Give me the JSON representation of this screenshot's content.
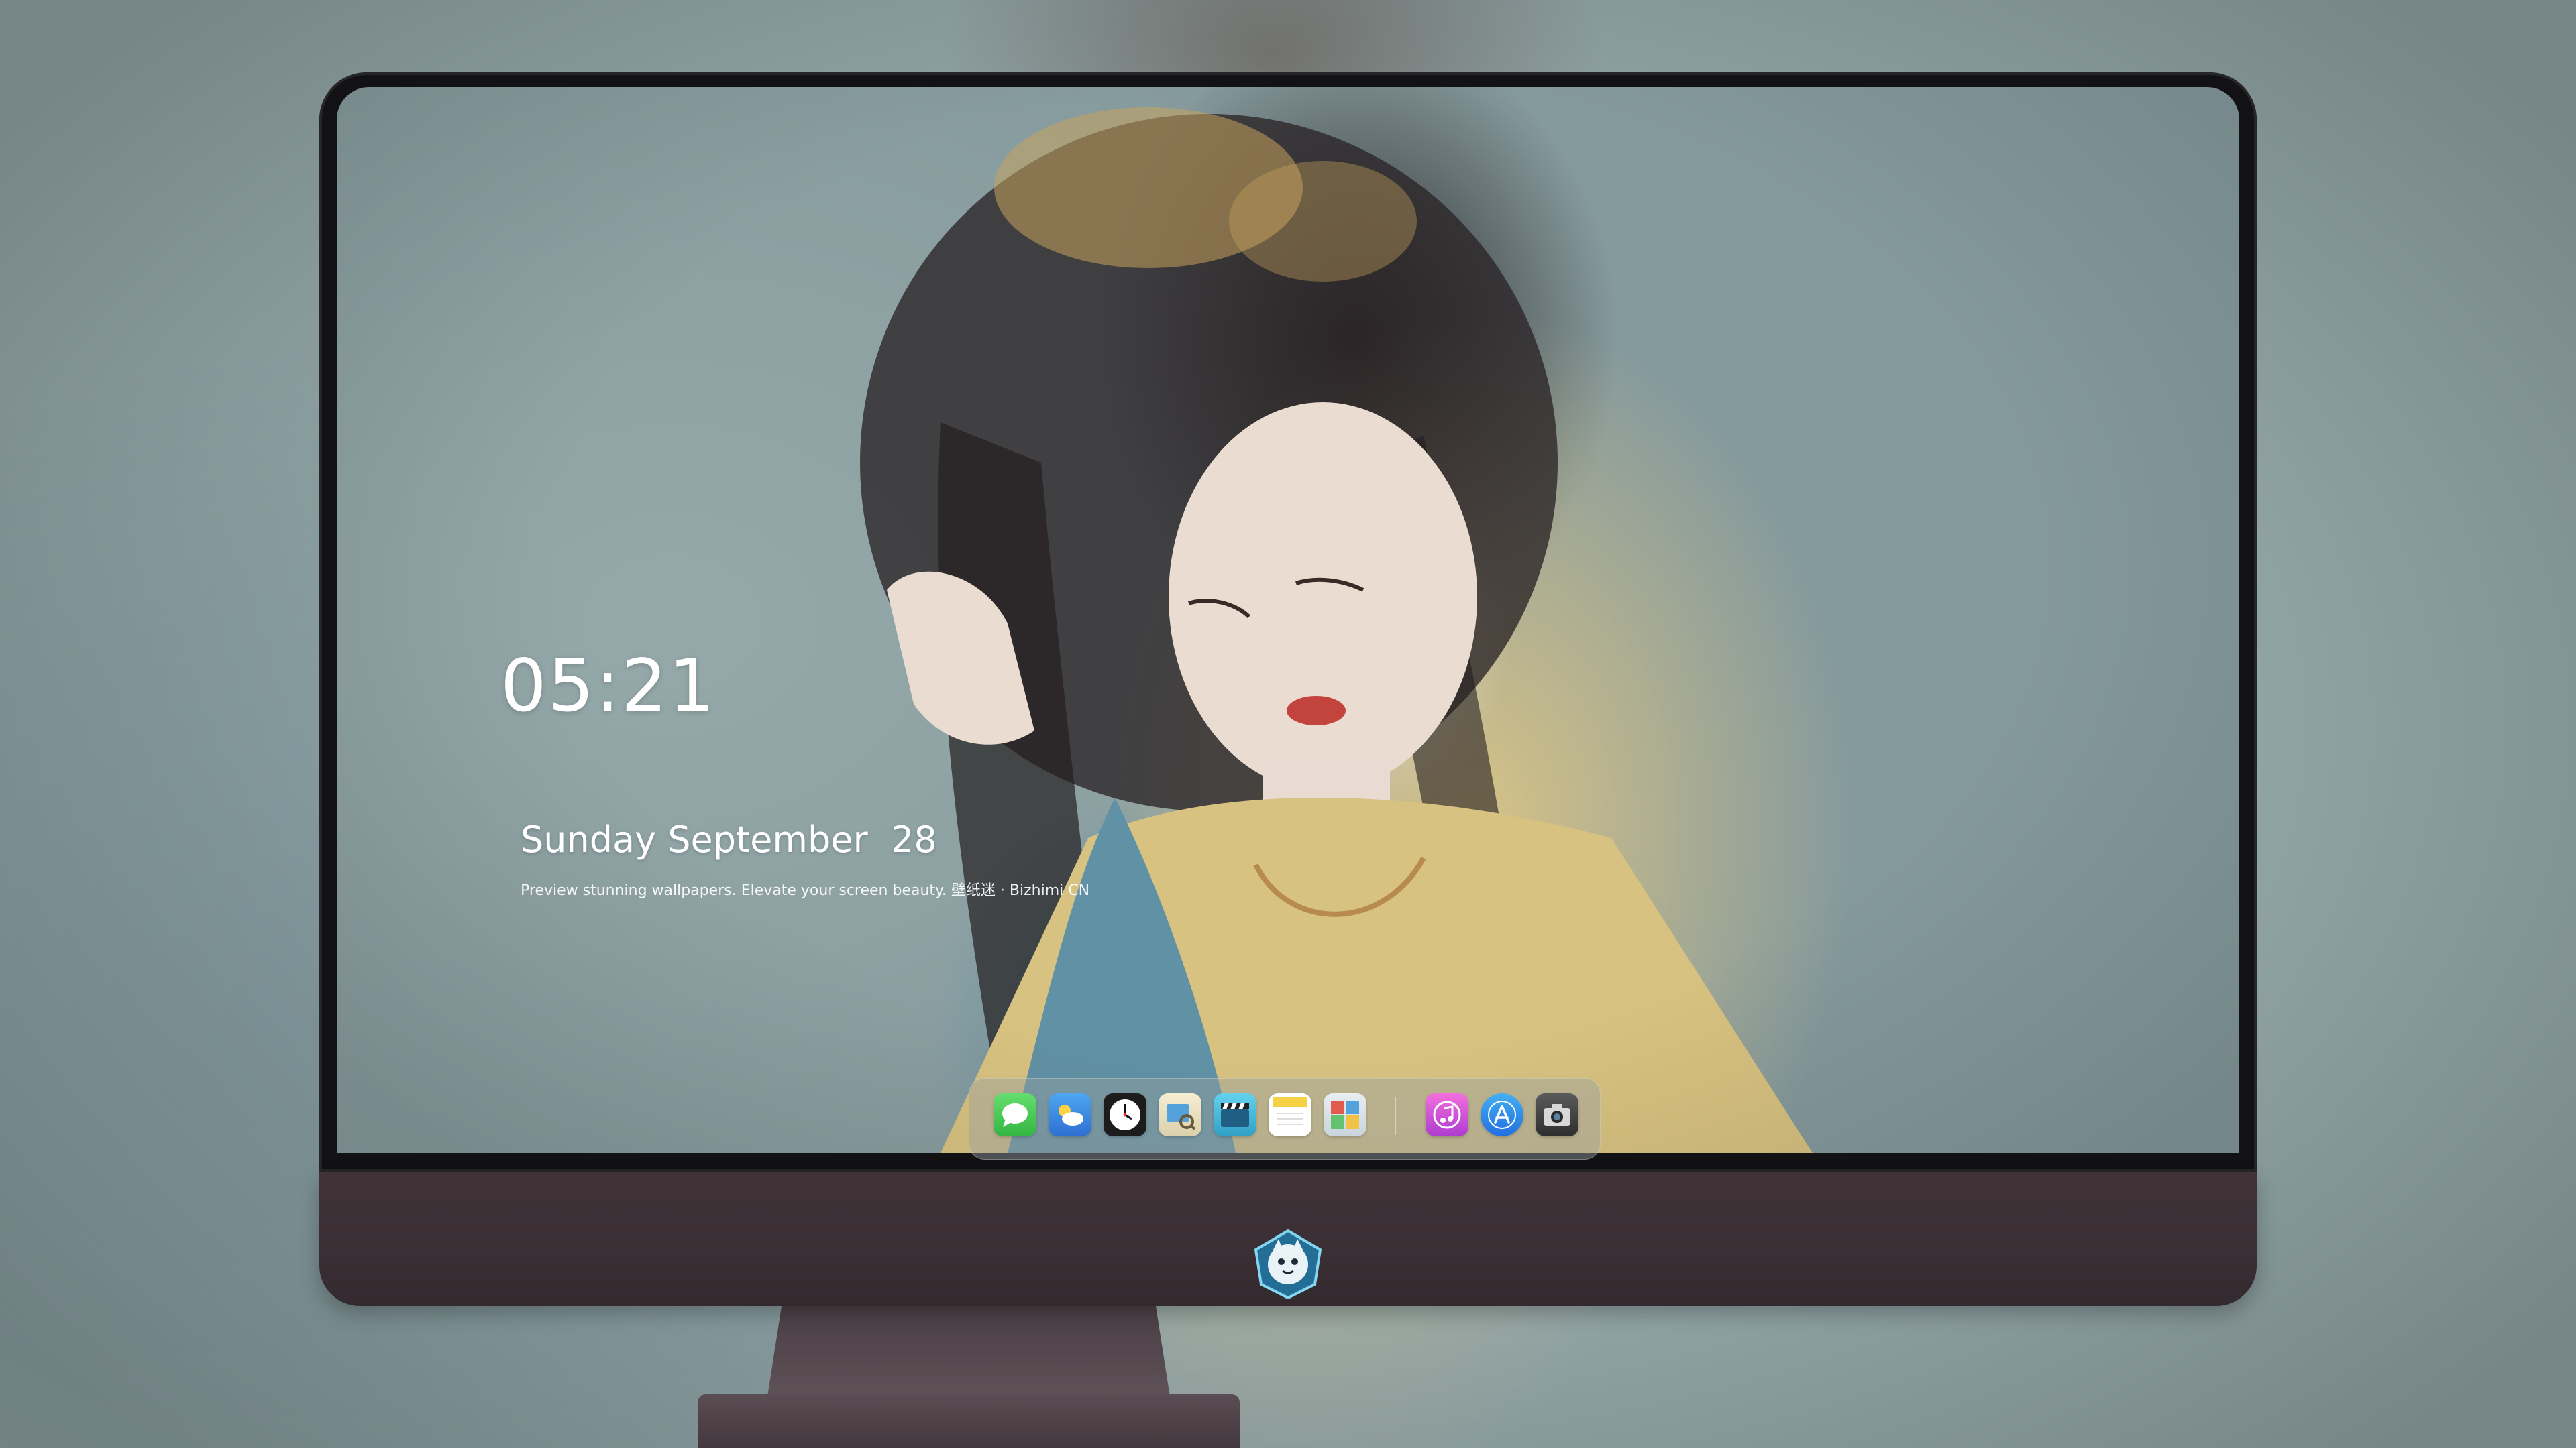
{
  "lockscreen": {
    "time": "05:21",
    "date": "Sunday September  28",
    "tagline": "Preview stunning wallpapers. Elevate your screen beauty. 壁纸迷 · Bizhimi CN"
  },
  "dock": {
    "apps": [
      {
        "name": "messages-icon",
        "color": "#3ec84d"
      },
      {
        "name": "weather-icon",
        "color": "#3a8fe8"
      },
      {
        "name": "clock-icon",
        "color": "#1c1c1c"
      },
      {
        "name": "preview-icon",
        "color": "#e9e2c8"
      },
      {
        "name": "video-icon",
        "color": "#3bb7d8"
      },
      {
        "name": "notes-icon",
        "color": "#f7d23e"
      },
      {
        "name": "photo-booth-icon",
        "color": "#5aa4d6"
      },
      {
        "name": "music-icon",
        "color": "#e83fd0"
      },
      {
        "name": "app-store-icon",
        "color": "#2f8df0"
      },
      {
        "name": "camera-icon",
        "color": "#4a4a4a"
      }
    ]
  },
  "colors": {
    "monitor_chin": "#3a2f34",
    "bezel": "#121214",
    "text": "#ffffff"
  }
}
